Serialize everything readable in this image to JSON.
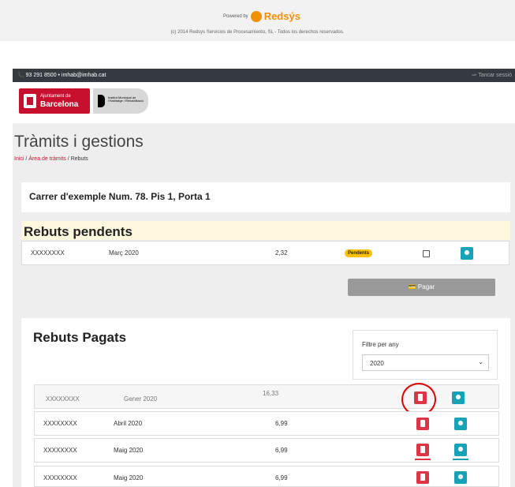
{
  "redsys": {
    "powered_by": "Powered by",
    "brand": "Redsýs",
    "copyright": "(c) 2014 Redsys Servicios de Procesamiento, SL - Todos los derechos reservados."
  },
  "topbar": {
    "contact": "📞 93 291 8500 • imhab@imhab.cat",
    "logout": "⇨ Tancar sessió"
  },
  "logos": {
    "ajuntament_line1": "Ajuntament de",
    "ajuntament_line2": "Barcelona",
    "imhab_text": "Institut Municipal de l'Habitatge i Rehabilitació"
  },
  "header": {
    "title": "Tràmits i gestions",
    "breadcrumb": {
      "home": "Inici",
      "sep1": " / ",
      "area": "Àrea de tràmits",
      "sep2": " / ",
      "current": "Rebuts"
    }
  },
  "address": "Carrer d'exemple Num. 78. Pis 1, Porta 1",
  "pending": {
    "title": "Rebuts pendents",
    "rows": [
      {
        "ref": "XXXXXXXX",
        "period": "Març 2020",
        "amount": "2,32",
        "status": "Pendents"
      }
    ],
    "pay_label": "💳 Pagar"
  },
  "paid": {
    "title": "Rebuts Pagats",
    "filter_label": "Filtre per any",
    "filter_value": "2020",
    "rows": [
      {
        "ref": "XXXXXXXX",
        "period": "Gener 2020",
        "amount": "16,33"
      },
      {
        "ref": "XXXXXXXX",
        "period": "Abril 2020",
        "amount": "6,99"
      },
      {
        "ref": "XXXXXXXX",
        "period": "Maig 2020",
        "amount": "6,99"
      },
      {
        "ref": "XXXXXXXX",
        "period": "Maig 2020",
        "amount": "6,99"
      }
    ]
  },
  "colors": {
    "accent_red": "#dc3545",
    "info_teal": "#17a2b8",
    "pending_badge": "#ffc107",
    "topbar": "#343a40"
  }
}
